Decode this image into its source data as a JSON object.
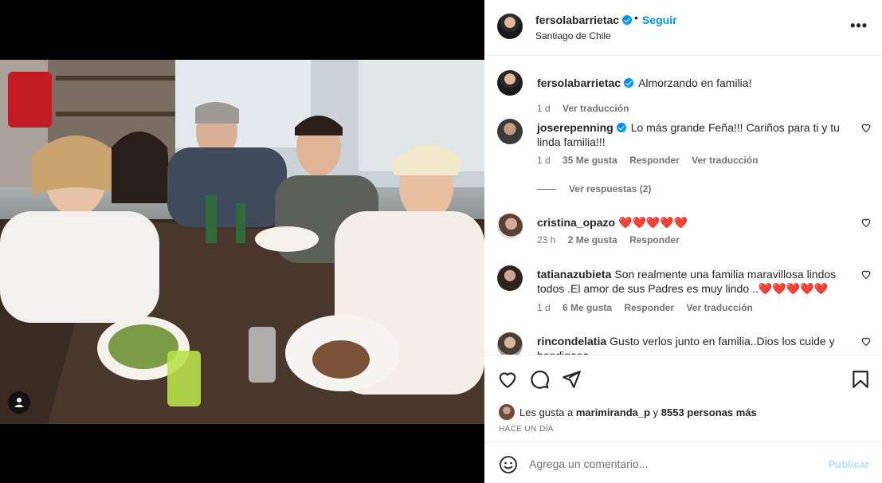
{
  "post": {
    "username": "fersolabarrietac",
    "follow_label": "Seguir",
    "dot": "•",
    "location": "Santiago de Chile",
    "more": "•••"
  },
  "caption": {
    "username": "fersolabarrietac",
    "text": "Almorzando en familia!",
    "time": "1 d",
    "translate": "Ver traducción"
  },
  "comments": [
    {
      "username": "joserepenning",
      "text": "Lo más grande Feña!!! Cariños para ti y tu linda familia!!!",
      "time": "1 d",
      "likes": "35 Me gusta",
      "reply": "Responder",
      "translate": "Ver traducción"
    },
    {
      "username": "cristina_opazo",
      "text": "",
      "hearts": "❤️❤️❤️❤️❤️",
      "time": "23 h",
      "likes": "2 Me gusta",
      "reply": "Responder"
    },
    {
      "username": "tatianazubieta",
      "text": "Son realmente una familia maravillosa lindos todos .El amor de sus Padres es muy lindo ..",
      "hearts": "❤️❤️❤️❤️❤️",
      "time": "1 d",
      "likes": "6 Me gusta",
      "reply": "Responder",
      "translate": "Ver traducción"
    },
    {
      "username": "rincondelatia",
      "text": "Gusto verlos junto en familia..Dios los cuide y bendigaaa"
    }
  ],
  "replies_label": "Ver respuestas (2)",
  "likes": {
    "prefix": "Les gusta a",
    "user": "marimiranda_p",
    "middle": "y",
    "count": "8553 personas más"
  },
  "timestamp": "HACE UN DÍA",
  "add_comment": {
    "placeholder": "Agrega un comentario...",
    "publish": "Publicar"
  },
  "colors": {
    "accent": "#0095f6",
    "publish_disabled": "#b2dffc",
    "heart_red": "#ed1c24"
  },
  "icons": [
    "user-icon",
    "verified-icon",
    "more-icon",
    "heart-icon",
    "comment-icon",
    "share-icon",
    "bookmark-icon",
    "emoji-icon"
  ]
}
